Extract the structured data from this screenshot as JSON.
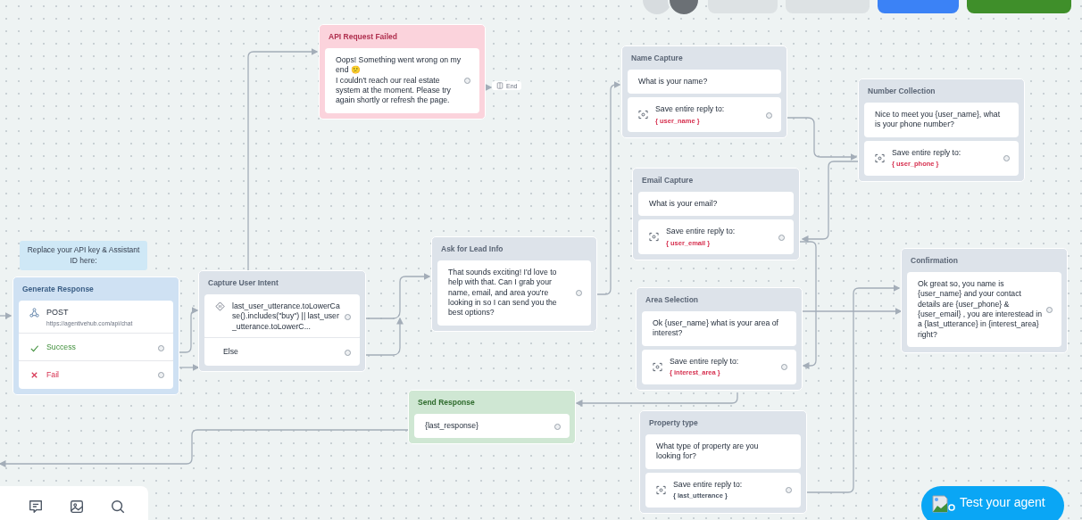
{
  "toolbar_top": {
    "avatars": [
      {
        "kind": "light"
      },
      {
        "kind": "dark"
      }
    ],
    "buttons": [
      {
        "kind": "share"
      },
      {
        "kind": "call"
      },
      {
        "kind": "run"
      },
      {
        "kind": "publish"
      }
    ]
  },
  "note": {
    "text": "Replace your API key & Assistant ID here:"
  },
  "nodes": [
    {
      "title": "API Request Failed",
      "kind": "error",
      "steps": [
        {
          "kind": "text",
          "text": "Oops! Something went wrong on my end 😕\nI couldn't reach our real estate system at the moment. Please try again shortly or refresh the page.",
          "port": true
        }
      ]
    },
    {
      "title": "Name Capture",
      "kind": "block",
      "steps": [
        {
          "kind": "text",
          "text": "What is your name?",
          "port": false
        },
        {
          "kind": "capture",
          "text": "Save entire reply to:",
          "variable": "{ user_name }",
          "color": "#d6304f",
          "port": true
        }
      ]
    },
    {
      "title": "Number Collection",
      "kind": "block",
      "steps": [
        {
          "kind": "text",
          "text": "Nice to meet you {user_name}, what is your phone number?",
          "port": false
        },
        {
          "kind": "capture",
          "text": "Save entire reply to:",
          "variable": "{ user_phone }",
          "color": "#d6304f",
          "port": true
        }
      ]
    },
    {
      "title": "Email Capture",
      "kind": "block",
      "steps": [
        {
          "kind": "text",
          "text": "What is your email?",
          "port": false
        },
        {
          "kind": "capture",
          "text": "Save entire reply to:",
          "variable": "{ user_email }",
          "color": "#d6304f",
          "port": true
        }
      ]
    },
    {
      "title": "Ask for Lead Info",
      "kind": "block",
      "steps": [
        {
          "kind": "text",
          "text": "That sounds exciting! I'd love to help with that. Can I grab your name, email, and area you're looking in so I can send you the best options?",
          "port": true
        }
      ]
    },
    {
      "title": "Confirmation",
      "kind": "block",
      "steps": [
        {
          "kind": "text",
          "text": "Ok great so, you name is {user_name} and your contact details are {user_phone} & {user_email} , you are interestead in a {last_utterance} in {interest_area} right?",
          "port": true
        }
      ]
    },
    {
      "title": "Capture User Intent",
      "kind": "block",
      "steps": [
        {
          "kind": "condition",
          "text": "last_user_utterance.toLowerCase().includes(\"buy\") || last_user_utterance.toLowerC...",
          "port": true
        },
        {
          "kind": "else",
          "text": "Else",
          "port": true
        }
      ]
    },
    {
      "title": "Generate Response",
      "kind": "api",
      "steps": [
        {
          "kind": "api",
          "text": "POST",
          "url": "https://agentivehub.com/api/chat",
          "port": false
        },
        {
          "kind": "success",
          "text": "Success",
          "port": true
        },
        {
          "kind": "fail",
          "text": "Fail",
          "port": true
        }
      ]
    },
    {
      "title": "Area Selection",
      "kind": "block",
      "steps": [
        {
          "kind": "text",
          "text": "Ok {user_name} what is your area of interest?",
          "port": false
        },
        {
          "kind": "capture",
          "text": "Save entire reply to:",
          "variable": "{ interest_area }",
          "color": "#d6304f",
          "port": true
        }
      ]
    },
    {
      "title": "Send Response",
      "kind": "response",
      "steps": [
        {
          "kind": "text",
          "text": "{last_response}",
          "port": true
        }
      ]
    },
    {
      "title": "Property type",
      "kind": "block",
      "steps": [
        {
          "kind": "text",
          "text": "What type of property are you looking for?",
          "port": false
        },
        {
          "kind": "capture",
          "text": "Save entire reply to:",
          "variable": "{ last_utterance }",
          "color": "#4b5563",
          "port": true
        }
      ]
    }
  ],
  "end_marker": {
    "label": "End"
  },
  "bottom_toolbar": {
    "tools": [
      {
        "kind": "comment"
      },
      {
        "kind": "image"
      },
      {
        "kind": "search"
      }
    ]
  },
  "test_button": {
    "label": "Test your agent"
  }
}
